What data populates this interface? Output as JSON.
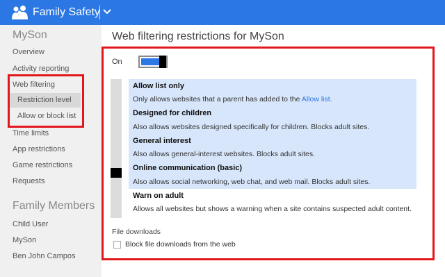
{
  "header": {
    "app_title": "Family Safety",
    "logo_icon": "family-people-icon",
    "menu_icon": "chevron-down-icon",
    "bar_color": "#2b78e4"
  },
  "sidebar": {
    "child_name": "MySon",
    "items": [
      {
        "label": "Overview"
      },
      {
        "label": "Activity reporting"
      },
      {
        "label": "Web filtering"
      },
      {
        "label": "Restriction level",
        "active": true
      },
      {
        "label": "Allow or block list"
      },
      {
        "label": "Time limits"
      },
      {
        "label": "App restrictions"
      },
      {
        "label": "Game restrictions"
      },
      {
        "label": "Requests"
      }
    ],
    "members_heading": "Family Members",
    "members": [
      {
        "label": "Child User"
      },
      {
        "label": "MySon"
      },
      {
        "label": "Ben John Campos"
      }
    ]
  },
  "main": {
    "title": "Web filtering restrictions for MySon",
    "toggle_label": "On",
    "toggle_on": true,
    "levels": [
      {
        "title": "Allow list only",
        "desc": "Only allows websites that a parent has added to the ",
        "link": "Allow list."
      },
      {
        "title": "Designed for children",
        "desc": "Also allows websites designed specifically for children. Blocks adult sites."
      },
      {
        "title": "General interest",
        "desc": "Also allows general-interest websites. Blocks adult sites."
      },
      {
        "title": "Online communication (basic)",
        "desc": "Also allows social networking, web chat, and web mail. Blocks adult sites."
      },
      {
        "title": "Warn on adult",
        "desc": "Allows all websites but shows a warning when a site contains suspected adult content."
      }
    ],
    "selected_level_index": 3,
    "file_downloads_label": "File downloads",
    "block_downloads_label": "Block file downloads from the web",
    "block_downloads_checked": false
  },
  "colors": {
    "accent": "#2b78e4",
    "highlight_box": "#e3161b",
    "selected_levels_bg": "#d7e6fb"
  }
}
